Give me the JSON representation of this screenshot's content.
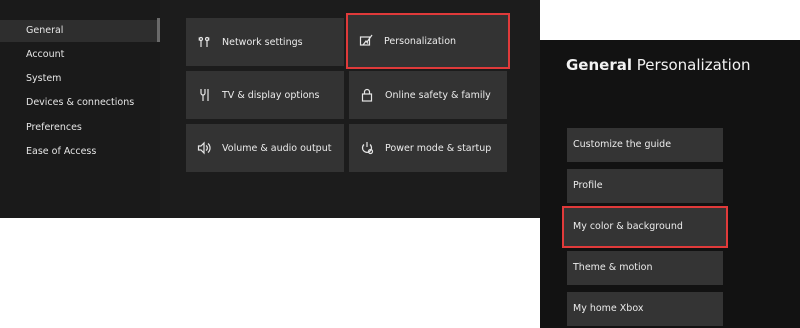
{
  "sidebar": {
    "items": [
      {
        "label": "General"
      },
      {
        "label": "Account"
      },
      {
        "label": "System"
      },
      {
        "label": "Devices & connections"
      },
      {
        "label": "Preferences"
      },
      {
        "label": "Ease of Access"
      }
    ]
  },
  "tiles": [
    {
      "label": "Network settings",
      "icon": "network-icon"
    },
    {
      "label": "Personalization",
      "icon": "personalization-icon"
    },
    {
      "label": "TV & display options",
      "icon": "tv-display-icon"
    },
    {
      "label": "Online safety & family",
      "icon": "lock-icon"
    },
    {
      "label": "Volume & audio output",
      "icon": "speaker-icon"
    },
    {
      "label": "Power mode & startup",
      "icon": "power-icon"
    }
  ],
  "personalization": {
    "title_bold": "General",
    "title_rest": "Personalization",
    "items": [
      {
        "label": "Customize the guide"
      },
      {
        "label": "Profile"
      },
      {
        "label": "My color & background"
      },
      {
        "label": "Theme & motion"
      },
      {
        "label": "My home Xbox"
      }
    ]
  },
  "colors": {
    "highlight": "#e03a3a",
    "tile_bg": "#333333",
    "panel_bg": "#1c1c1c"
  }
}
